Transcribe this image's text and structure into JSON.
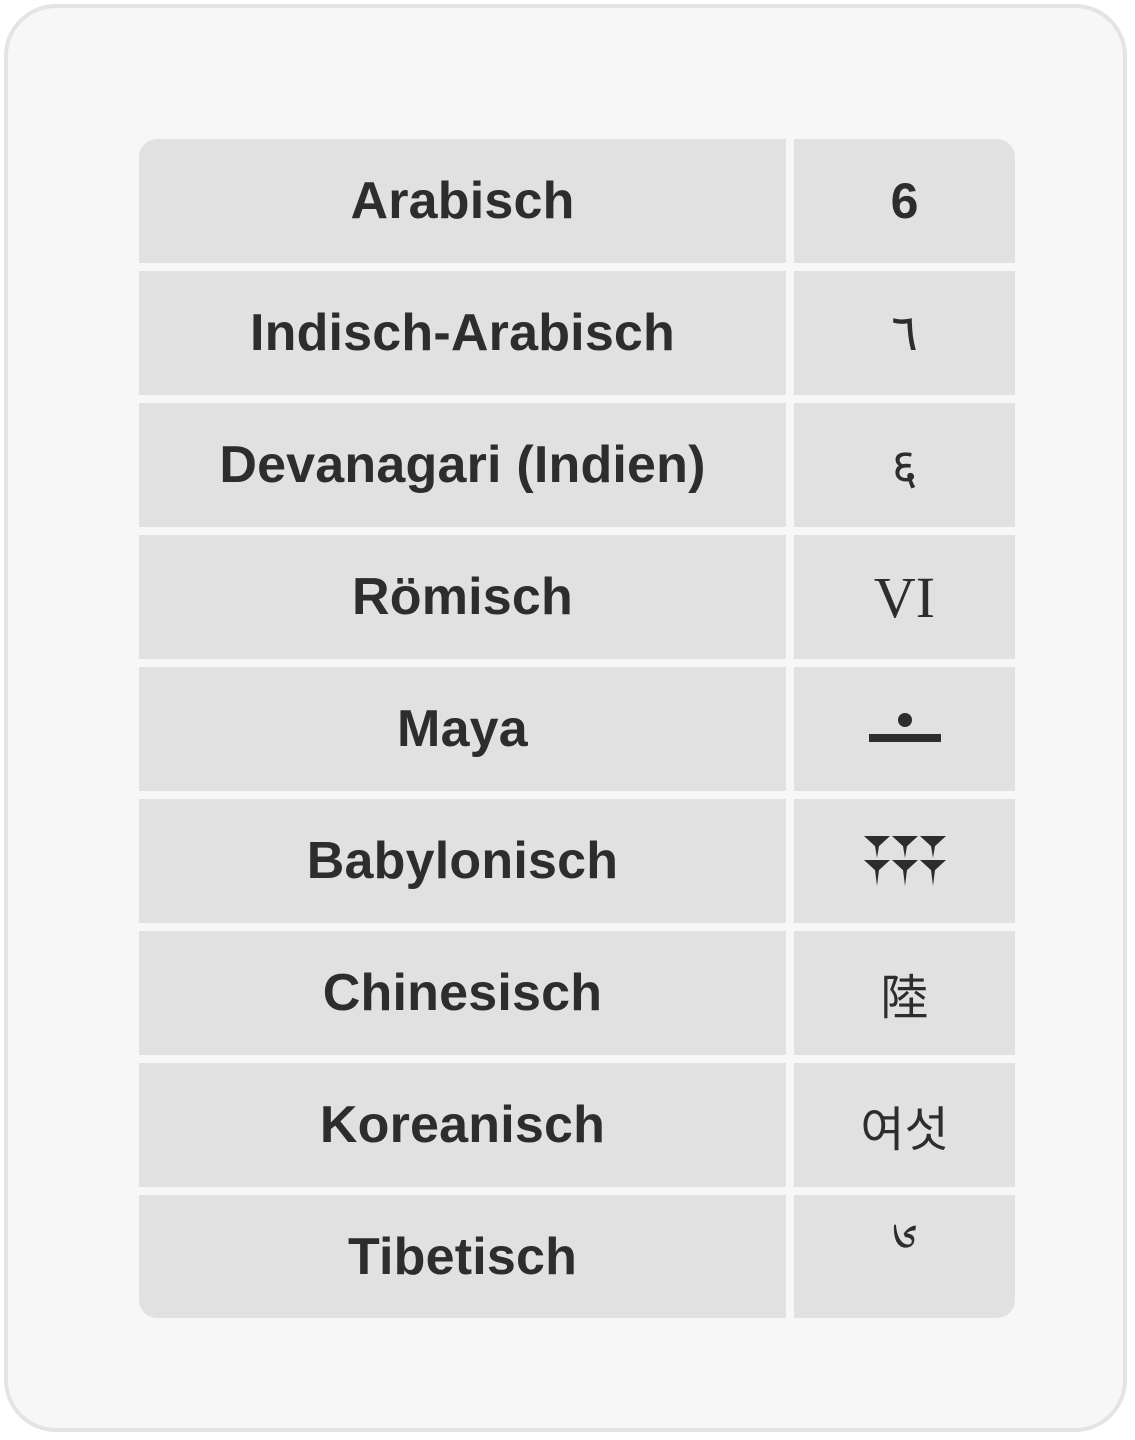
{
  "rows": [
    {
      "name": "Arabisch",
      "symbol": "6",
      "symbol_icon": ""
    },
    {
      "name": "Indisch-Arabisch",
      "symbol": "٦",
      "symbol_icon": ""
    },
    {
      "name": "Devanagari (Indien)",
      "symbol": "६",
      "symbol_icon": ""
    },
    {
      "name": "Römisch",
      "symbol": "VI",
      "symbol_icon": ""
    },
    {
      "name": "Maya",
      "symbol": "",
      "symbol_icon": "maya-six-glyph-icon"
    },
    {
      "name": "Babylonisch",
      "symbol": "",
      "symbol_icon": "babylonian-six-wedges-icon"
    },
    {
      "name": "Chinesisch",
      "symbol": "陸",
      "symbol_icon": ""
    },
    {
      "name": "Koreanisch",
      "symbol": "여섯",
      "symbol_icon": ""
    },
    {
      "name": "Tibetisch",
      "symbol": "༦",
      "symbol_icon": ""
    }
  ],
  "colors": {
    "page_background": "#f7f7f7",
    "page_border": "#e4e4e4",
    "cell_background": "#e1e1e1",
    "text": "#2d2d2d"
  }
}
